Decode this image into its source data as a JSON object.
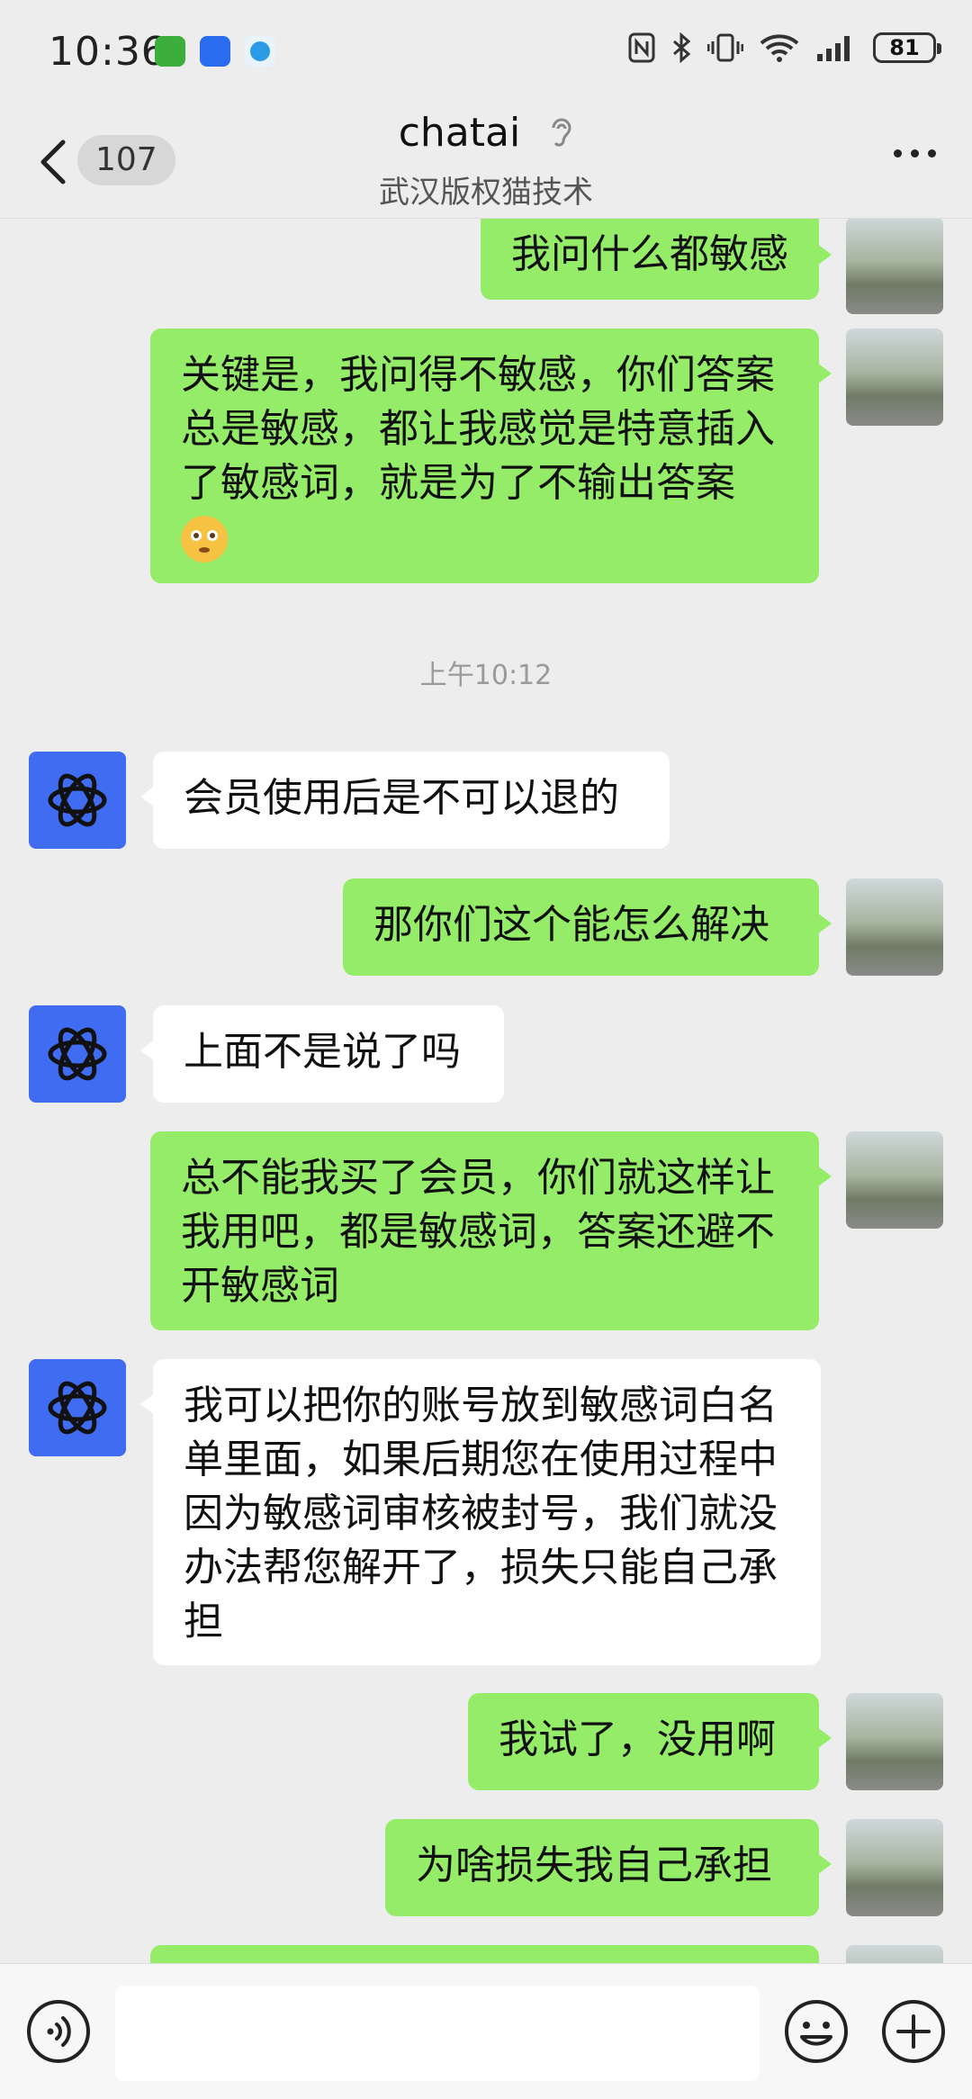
{
  "status_bar": {
    "time": "10:36",
    "battery": "81",
    "icons": [
      "nfc-icon",
      "bluetooth-icon",
      "vibrate-icon",
      "wifi-icon",
      "signal-icon"
    ]
  },
  "header": {
    "back_count": "107",
    "title": "chatai",
    "subtitle": "武汉版权猫技术"
  },
  "messages": [
    {
      "side": "out",
      "text": "我问什么都敏感"
    },
    {
      "side": "out",
      "text": "关键是，我问得不敏感，你们答案总是敏感，都让我感觉是特意插入了敏感词，就是为了不输出答案",
      "emoji": "flushed-face-emoji"
    },
    {
      "side": "time",
      "text": "上午10:12"
    },
    {
      "side": "in",
      "text": "会员使用后是不可以退的"
    },
    {
      "side": "out",
      "text": "那你们这个能怎么解决"
    },
    {
      "side": "in",
      "text": "上面不是说了吗"
    },
    {
      "side": "out",
      "text": "总不能我买了会员，你们就这样让我用吧，都是敏感词，答案还避不开敏感词"
    },
    {
      "side": "in",
      "text": "我可以把你的账号放到敏感词白名单里面，如果后期您在使用过程中因为敏感词审核被封号，我们就没办法帮您解开了，损失只能自己承担"
    },
    {
      "side": "out",
      "text": "我试了，没用啊"
    },
    {
      "side": "out",
      "text": "为啥损失我自己承担"
    }
  ],
  "input_bar": {
    "input_value": "",
    "icons": [
      "voice-icon",
      "emoji-icon",
      "plus-icon"
    ]
  },
  "colors": {
    "background": "#ededed",
    "outgoing_bubble": "#95ec69",
    "incoming_bubble": "#ffffff",
    "bot_avatar": "#3f6cf0"
  }
}
